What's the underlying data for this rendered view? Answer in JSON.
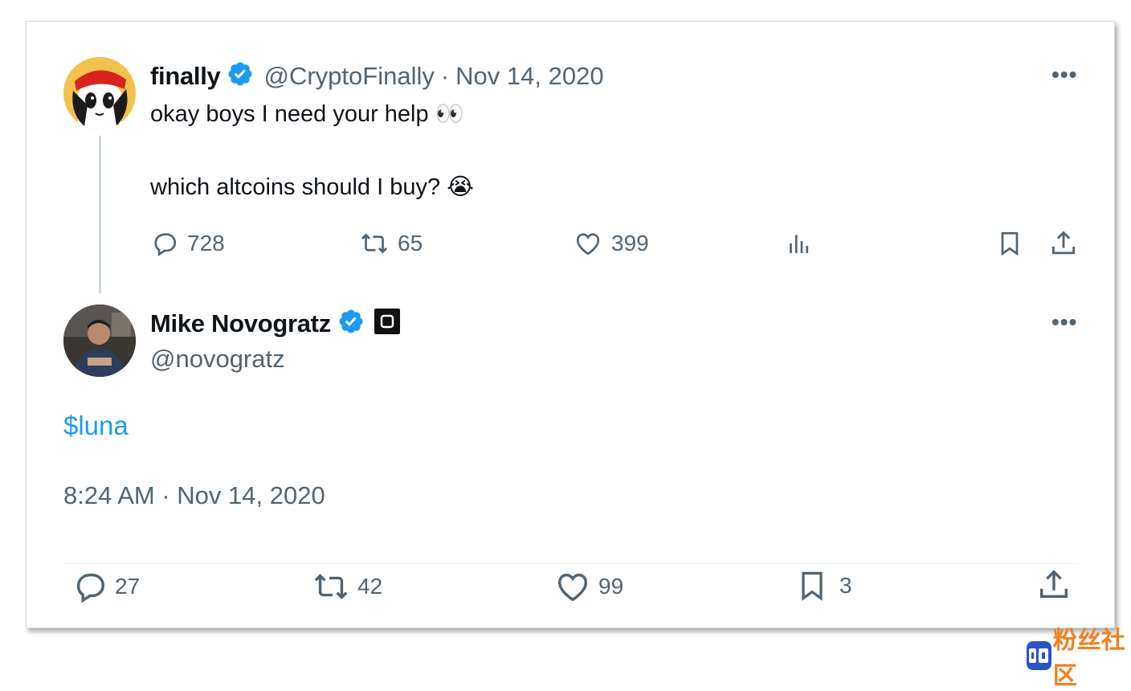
{
  "parent_tweet": {
    "display_name": "finally",
    "handle": "@CryptoFinally",
    "separator": "·",
    "date": "Nov 14, 2020",
    "text_line1": "okay boys I need your help 👀",
    "text_line2": "which altcoins should I buy? 😭",
    "more_label": "•••",
    "replies": "728",
    "reposts": "65",
    "likes": "399"
  },
  "reply_tweet": {
    "display_name": "Mike Novogratz",
    "handle": "@novogratz",
    "more_label": "•••",
    "text": "$luna",
    "timestamp": "8:24 AM · Nov 14, 2020",
    "replies": "27",
    "reposts": "42",
    "likes": "99",
    "bookmarks": "3"
  },
  "colors": {
    "verified": "#1d9bf0",
    "link": "#1d9bf0",
    "muted": "#536471",
    "watermark": "#f0821e"
  },
  "icons": {
    "reply": "speech-bubble-icon",
    "repost": "repost-arrows-icon",
    "like": "heart-icon",
    "views": "bar-chart-icon",
    "bookmark": "bookmark-icon",
    "share": "upload-share-icon"
  },
  "watermark": {
    "text": "粉丝社区"
  }
}
